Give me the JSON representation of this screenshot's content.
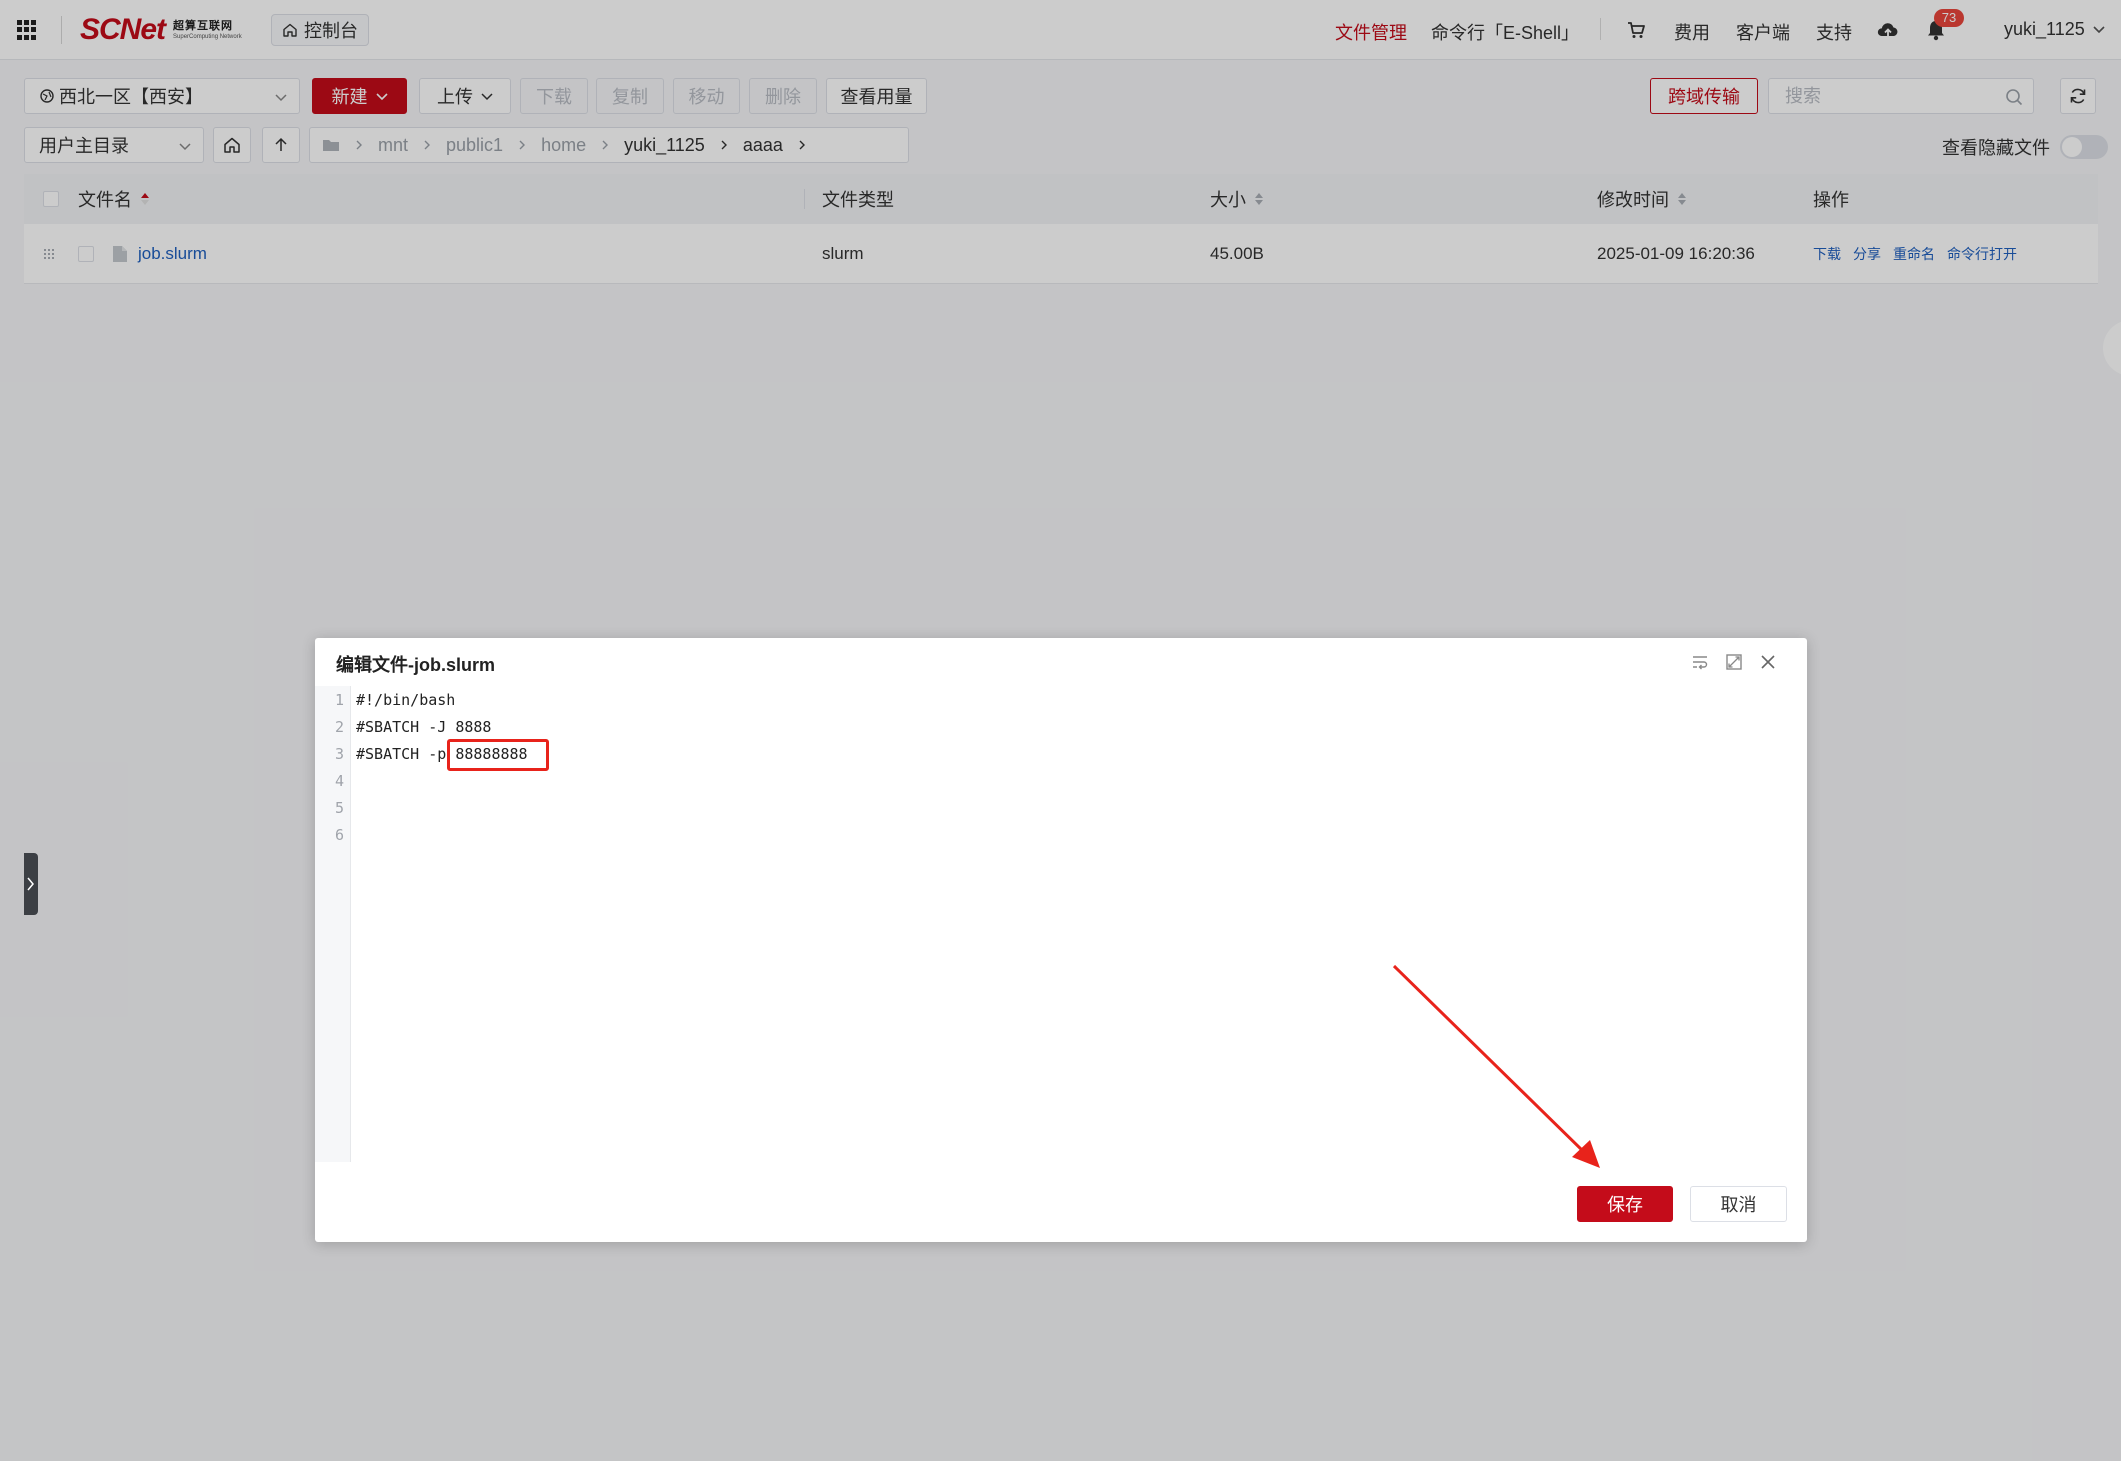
{
  "nav": {
    "logo_main": "SCNet",
    "logo_cn": "超算互联网",
    "logo_en": "SuperComputing Network",
    "console_label": "控制台",
    "links": {
      "file_manager": "文件管理",
      "eshell": "命令行「E-Shell」",
      "billing": "费用",
      "client": "客户端",
      "support": "支持",
      "user": "yuki_1125"
    },
    "notification_count": "73"
  },
  "toolbar": {
    "region": "西北一区【西安】",
    "new_label": "新建",
    "upload_label": "上传",
    "download_label": "下载",
    "copy_label": "复制",
    "move_label": "移动",
    "delete_label": "删除",
    "usage_label": "查看用量",
    "cross_domain_label": "跨域传输",
    "search_placeholder": "搜索"
  },
  "pathbar": {
    "root_select": "用户主目录",
    "crumbs": [
      "mnt",
      "public1",
      "home",
      "yuki_1125",
      "aaaa"
    ],
    "show_hidden_label": "查看隐藏文件"
  },
  "table": {
    "headers": {
      "name": "文件名",
      "type": "文件类型",
      "size": "大小",
      "mtime": "修改时间",
      "ops": "操作"
    },
    "rows": [
      {
        "name": "job.slurm",
        "type": "slurm",
        "size": "45.00B",
        "mtime": "2025-01-09 16:20:36",
        "ops": [
          "下载",
          "分享",
          "重命名",
          "命令行打开"
        ]
      }
    ]
  },
  "modal": {
    "title": "编辑文件-job.slurm",
    "lines": [
      {
        "no": "1",
        "text": "#!/bin/bash"
      },
      {
        "no": "2",
        "text": "#SBATCH -J 8888"
      },
      {
        "no": "3",
        "text": "#SBATCH -p 88888888"
      },
      {
        "no": "4",
        "text": ""
      },
      {
        "no": "5",
        "text": ""
      },
      {
        "no": "6",
        "text": ""
      }
    ],
    "save_label": "保存",
    "cancel_label": "取消"
  },
  "colors": {
    "brand_red": "#c40c1a",
    "link_blue": "#1f5fbf",
    "annotation_red": "#e8231b"
  }
}
